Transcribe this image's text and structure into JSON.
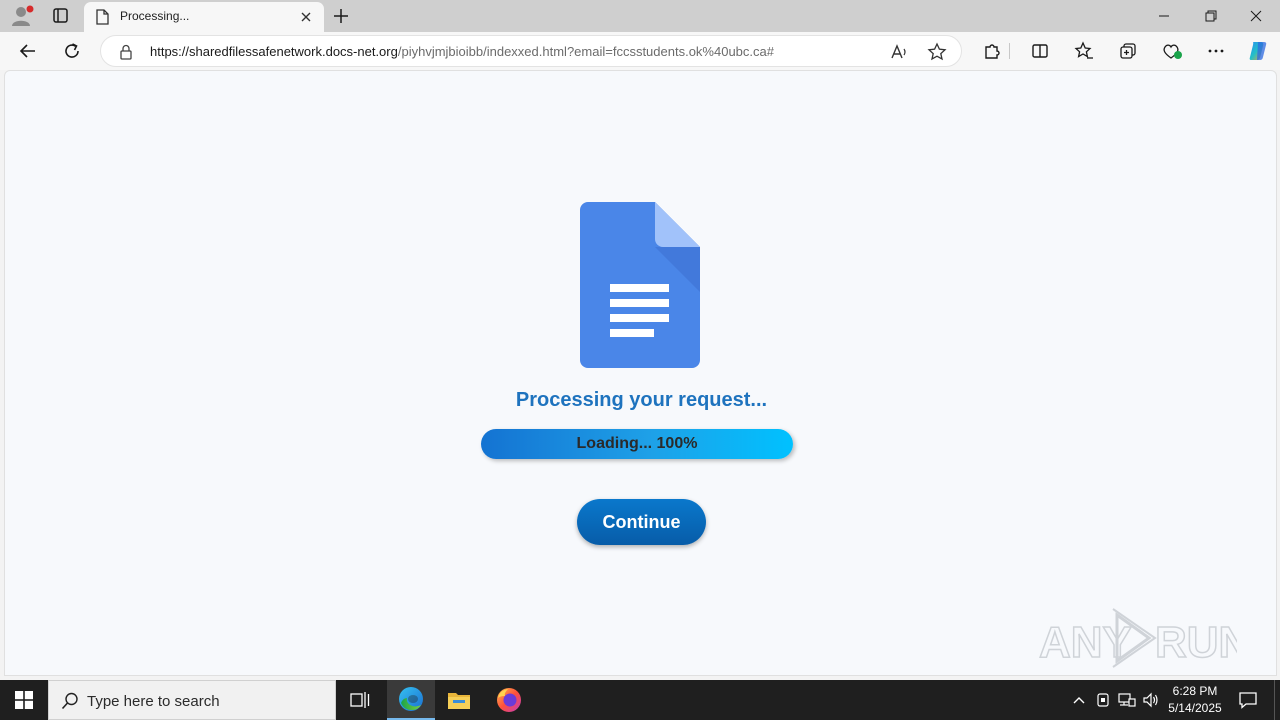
{
  "browser": {
    "tab_title": "Processing...",
    "url_host": "https://sharedfilessafenetwork.docs-net.org",
    "url_path": "/piyhvjmjbioibb/indexxed.html?email=fccsstudents.ok%40ubc.ca#"
  },
  "page": {
    "heading": "Processing your request...",
    "progress_label": "Loading... 100%",
    "progress_fraction": 1.0,
    "continue_label": "Continue",
    "watermark_text": "ANY RUN"
  },
  "taskbar": {
    "search_placeholder": "Type here to search",
    "time": "6:28 PM",
    "date": "5/14/2025"
  },
  "colors": {
    "heading": "#1e73be",
    "doc_blue": "#4a86e8",
    "button": "#0a6fbf",
    "progress_start": "#1473d2",
    "progress_end": "#00c1ff"
  }
}
